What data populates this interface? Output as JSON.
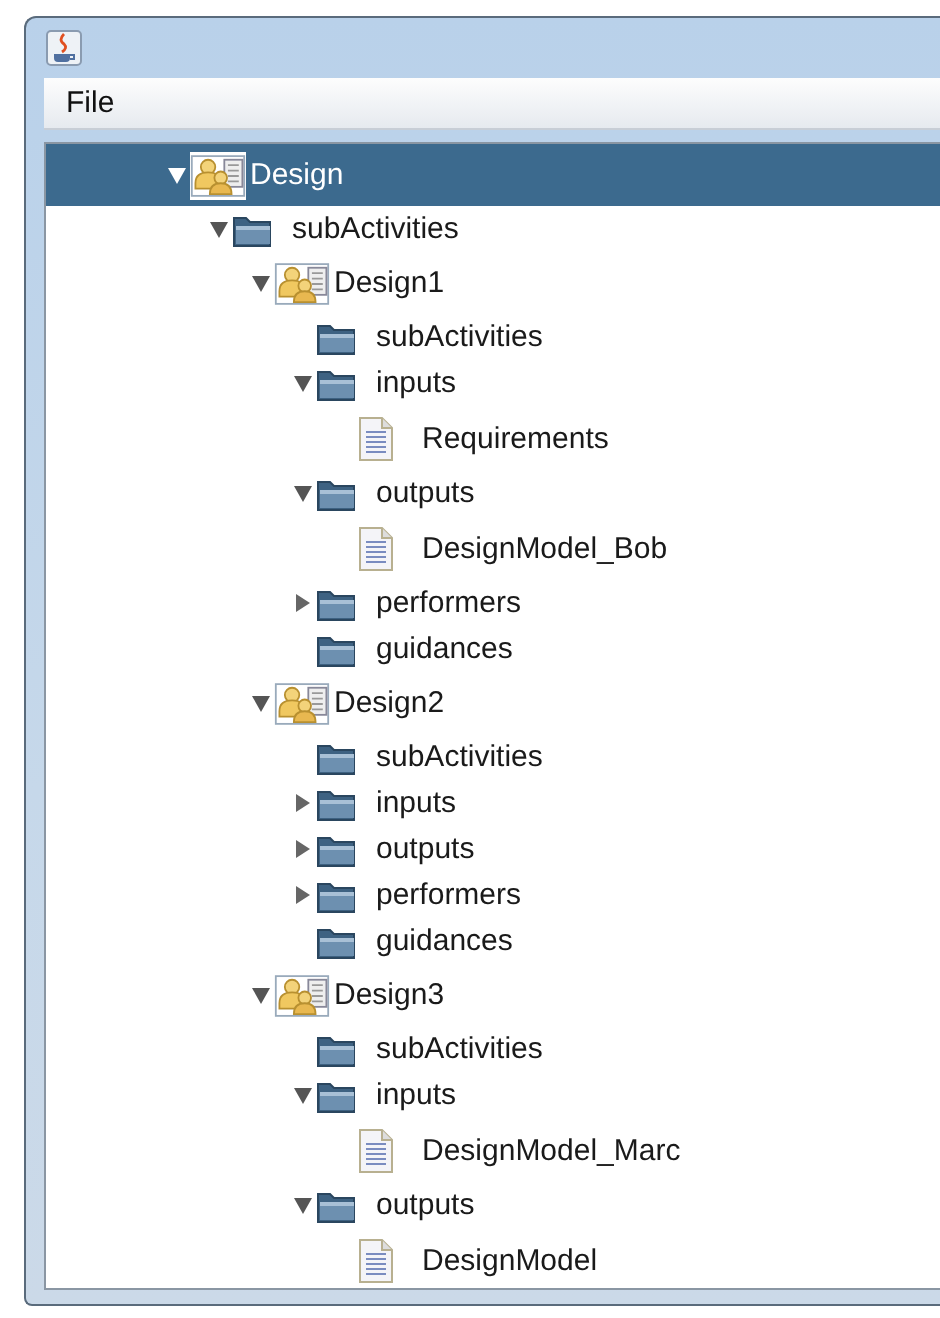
{
  "menu": [
    {
      "label": "File"
    }
  ],
  "tree": [
    {
      "kind": "activity",
      "label": "Design",
      "expanded": true,
      "selected": true,
      "children": [
        {
          "kind": "folder",
          "label": "subActivities",
          "expanded": true,
          "selected": false,
          "children": [
            {
              "kind": "activity",
              "label": "Design1",
              "expanded": true,
              "selected": false,
              "children": [
                {
                  "kind": "folder",
                  "label": "subActivities",
                  "selected": false
                },
                {
                  "kind": "folder",
                  "label": "inputs",
                  "expanded": true,
                  "selected": false,
                  "children": [
                    {
                      "kind": "document",
                      "label": "Requirements",
                      "selected": false
                    }
                  ]
                },
                {
                  "kind": "folder",
                  "label": "outputs",
                  "expanded": true,
                  "selected": false,
                  "children": [
                    {
                      "kind": "document",
                      "label": "DesignModel_Bob",
                      "selected": false
                    }
                  ]
                },
                {
                  "kind": "folder",
                  "label": "performers",
                  "expanded": false,
                  "selected": false
                },
                {
                  "kind": "folder",
                  "label": "guidances",
                  "selected": false
                }
              ]
            },
            {
              "kind": "activity",
              "label": "Design2",
              "expanded": true,
              "selected": false,
              "children": [
                {
                  "kind": "folder",
                  "label": "subActivities",
                  "selected": false
                },
                {
                  "kind": "folder",
                  "label": "inputs",
                  "expanded": false,
                  "selected": false
                },
                {
                  "kind": "folder",
                  "label": "outputs",
                  "expanded": false,
                  "selected": false
                },
                {
                  "kind": "folder",
                  "label": "performers",
                  "expanded": false,
                  "selected": false
                },
                {
                  "kind": "folder",
                  "label": "guidances",
                  "selected": false
                }
              ]
            },
            {
              "kind": "activity",
              "label": "Design3",
              "expanded": true,
              "selected": false,
              "children": [
                {
                  "kind": "folder",
                  "label": "subActivities",
                  "selected": false
                },
                {
                  "kind": "folder",
                  "label": "inputs",
                  "expanded": true,
                  "selected": false,
                  "children": [
                    {
                      "kind": "document",
                      "label": "DesignModel_Marc",
                      "selected": false
                    }
                  ]
                },
                {
                  "kind": "folder",
                  "label": "outputs",
                  "expanded": true,
                  "selected": false,
                  "children": [
                    {
                      "kind": "document",
                      "label": "DesignModel",
                      "selected": false
                    }
                  ]
                }
              ]
            }
          ]
        }
      ]
    }
  ]
}
